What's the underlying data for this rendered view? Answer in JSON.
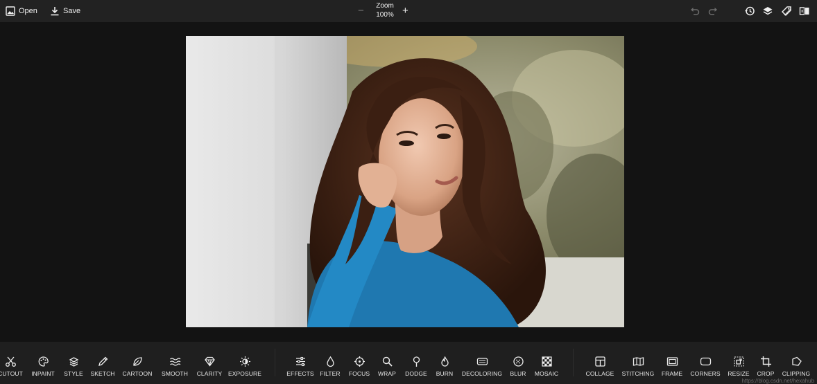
{
  "topbar": {
    "open_label": "Open",
    "save_label": "Save",
    "zoom_label": "Zoom",
    "zoom_value": "100%",
    "zoom_minus": "−",
    "zoom_plus": "+",
    "icons": [
      "undo-icon",
      "redo-icon",
      "history-icon",
      "layers-icon",
      "tag-icon",
      "compare-icon"
    ]
  },
  "tools_group1": [
    "CUTOUT",
    "INPAINT",
    "STYLE",
    "SKETCH",
    "CARTOON",
    "SMOOTH",
    "CLARITY",
    "EXPOSURE"
  ],
  "tools_group2": [
    "EFFECTS",
    "FILTER",
    "FOCUS",
    "WRAP",
    "DODGE",
    "BURN",
    "DECOLORING",
    "BLUR",
    "MOSAIC"
  ],
  "tools_group3": [
    "COLLAGE",
    "STITCHING",
    "FRAME",
    "CORNERS",
    "RESIZE",
    "CROP",
    "CLIPPING"
  ],
  "watermark": "https://blog.csdn.net/hexahub",
  "colors": {
    "topbar": "#222222",
    "background": "#131313",
    "bottombar": "#1f1f1f",
    "text": "#f0f0f0"
  }
}
